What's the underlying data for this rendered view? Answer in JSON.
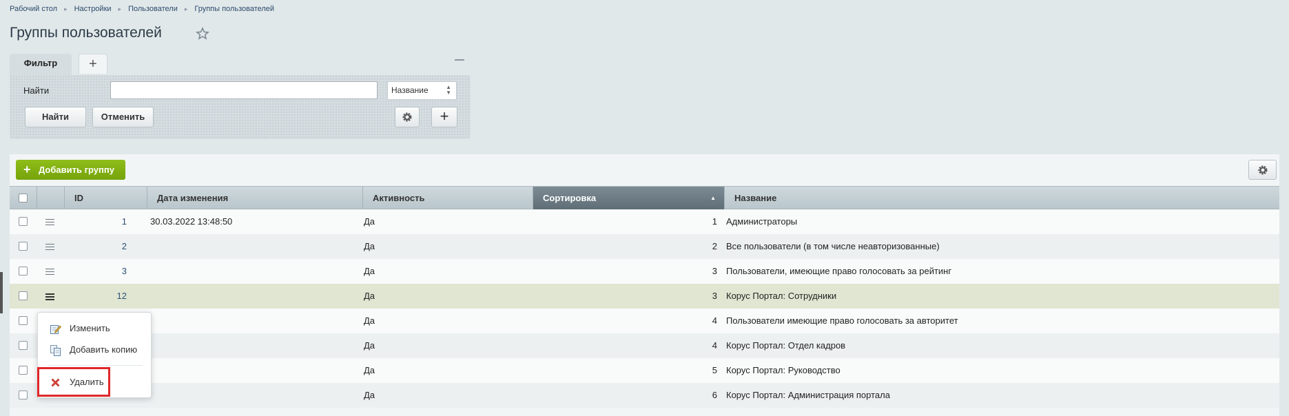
{
  "breadcrumb": {
    "items": [
      "Рабочий стол",
      "Настройки",
      "Пользователи",
      "Группы пользователей"
    ]
  },
  "page_title": "Группы пользователей",
  "filter": {
    "tab_label": "Фильтр",
    "search_label": "Найти",
    "search_value": "",
    "field_select_value": "Название",
    "find_button": "Найти",
    "cancel_button": "Отменить"
  },
  "toolbar": {
    "add_group_button": "Добавить группу"
  },
  "table": {
    "columns": {
      "id": "ID",
      "date": "Дата изменения",
      "active": "Активность",
      "sort": "Сортировка",
      "name": "Название"
    },
    "rows": [
      {
        "id": "1",
        "date": "30.03.2022 13:48:50",
        "active": "Да",
        "sort": "1",
        "name": "Администраторы"
      },
      {
        "id": "2",
        "date": "",
        "active": "Да",
        "sort": "2",
        "name": "Все пользователи (в том числе неавторизованные)"
      },
      {
        "id": "3",
        "date": "",
        "active": "Да",
        "sort": "3",
        "name": "Пользователи, имеющие право голосовать за рейтинг"
      },
      {
        "id": "12",
        "date": "",
        "active": "Да",
        "sort": "3",
        "name": "Корус Портал: Сотрудники"
      },
      {
        "id": "",
        "date": "",
        "active": "Да",
        "sort": "4",
        "name": "Пользователи имеющие право голосовать за авторитет"
      },
      {
        "id": "",
        "date": "",
        "active": "Да",
        "sort": "4",
        "name": "Корус Портал: Отдел кадров"
      },
      {
        "id": "",
        "date": "",
        "active": "Да",
        "sort": "5",
        "name": "Корус Портал: Руководство"
      },
      {
        "id": "",
        "date": "",
        "active": "Да",
        "sort": "6",
        "name": "Корус Портал: Администрация портала"
      }
    ]
  },
  "context_menu": {
    "edit": "Изменить",
    "copy": "Добавить копию",
    "delete": "Удалить"
  },
  "colors": {
    "accent_green": "#7bab0f",
    "highlight_row": "#e1e6d2",
    "delete_outline": "#e0262a"
  }
}
